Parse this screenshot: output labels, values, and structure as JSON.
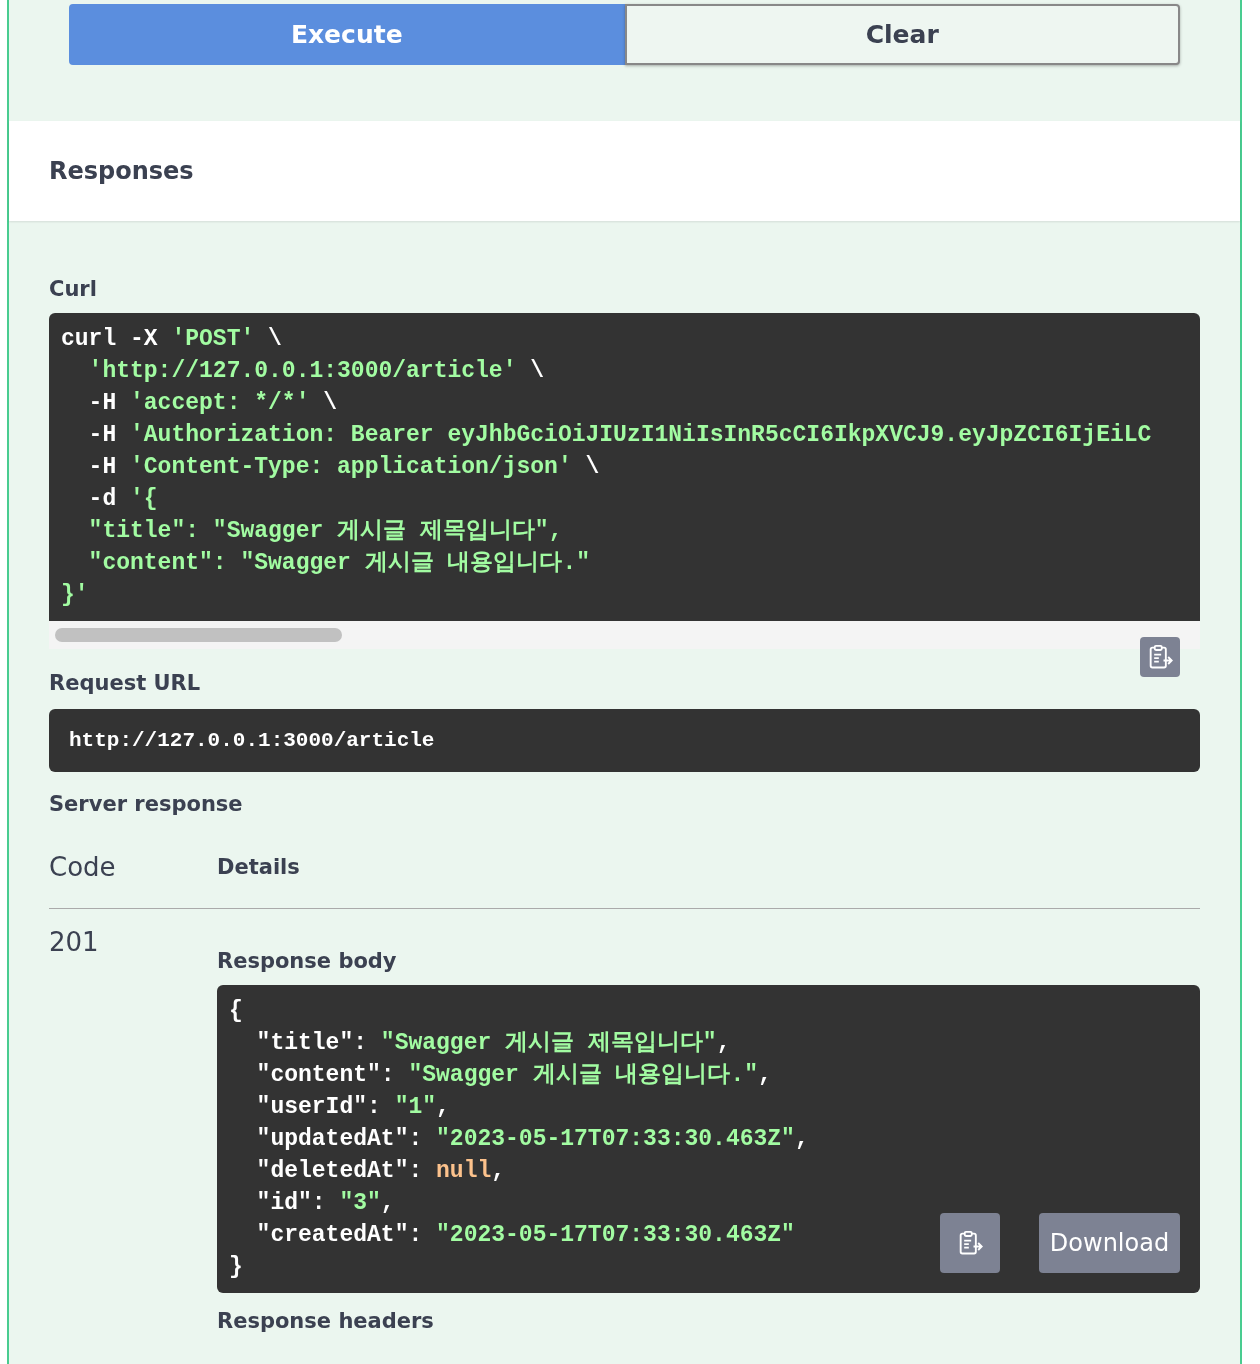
{
  "buttons": [
    {
      "label": "Execute",
      "kind": "primary"
    },
    {
      "label": "Clear",
      "kind": "secondary"
    }
  ],
  "responses_title": "Responses",
  "curl": {
    "label": "Curl",
    "lines": [
      [
        {
          "kind": "plain",
          "text": "curl -X "
        },
        {
          "kind": "string",
          "text": "'POST'"
        },
        {
          "kind": "plain",
          "text": " \\"
        }
      ],
      [
        {
          "kind": "string",
          "text": "  'http://127.0.0.1:3000/article'"
        },
        {
          "kind": "plain",
          "text": " \\"
        }
      ],
      [
        {
          "kind": "plain",
          "text": "  -H "
        },
        {
          "kind": "string",
          "text": "'accept: */*'"
        },
        {
          "kind": "plain",
          "text": " \\"
        }
      ],
      [
        {
          "kind": "plain",
          "text": "  -H "
        },
        {
          "kind": "string",
          "text": "'Authorization: Bearer eyJhbGciOiJIUzI1NiIsInR5cCI6IkpXVCJ9.eyJpZCI6IjEiLC"
        }
      ],
      [
        {
          "kind": "plain",
          "text": "  -H "
        },
        {
          "kind": "string",
          "text": "'Content-Type: application/json'"
        },
        {
          "kind": "plain",
          "text": " \\"
        }
      ],
      [
        {
          "kind": "plain",
          "text": "  -d "
        },
        {
          "kind": "string",
          "text": "'{"
        }
      ],
      [
        {
          "kind": "string",
          "text": "  \"title\": \"Swagger 게시글 제목입니다\","
        }
      ],
      [
        {
          "kind": "string",
          "text": "  \"content\": \"Swagger 게시글 내용입니다.\""
        }
      ],
      [
        {
          "kind": "string",
          "text": "}'"
        }
      ]
    ]
  },
  "request_url": {
    "label": "Request URL",
    "value": "http://127.0.0.1:3000/article"
  },
  "server_response": {
    "label": "Server response",
    "columns": [
      "Code",
      "Details"
    ],
    "code": "201",
    "body_label": "Response body",
    "body_lines": [
      [
        {
          "kind": "plain",
          "text": "{"
        }
      ],
      [
        {
          "kind": "plain",
          "text": "  \"title\": "
        },
        {
          "kind": "string",
          "text": "\"Swagger 게시글 제목입니다\""
        },
        {
          "kind": "plain",
          "text": ","
        }
      ],
      [
        {
          "kind": "plain",
          "text": "  \"content\": "
        },
        {
          "kind": "string",
          "text": "\"Swagger 게시글 내용입니다.\""
        },
        {
          "kind": "plain",
          "text": ","
        }
      ],
      [
        {
          "kind": "plain",
          "text": "  \"userId\": "
        },
        {
          "kind": "string",
          "text": "\"1\""
        },
        {
          "kind": "plain",
          "text": ","
        }
      ],
      [
        {
          "kind": "plain",
          "text": "  \"updatedAt\": "
        },
        {
          "kind": "string",
          "text": "\"2023-05-17T07:33:30.463Z\""
        },
        {
          "kind": "plain",
          "text": ","
        }
      ],
      [
        {
          "kind": "plain",
          "text": "  \"deletedAt\": "
        },
        {
          "kind": "null",
          "text": "null"
        },
        {
          "kind": "plain",
          "text": ","
        }
      ],
      [
        {
          "kind": "plain",
          "text": "  \"id\": "
        },
        {
          "kind": "string",
          "text": "\"3\""
        },
        {
          "kind": "plain",
          "text": ","
        }
      ],
      [
        {
          "kind": "plain",
          "text": "  \"createdAt\": "
        },
        {
          "kind": "string",
          "text": "\"2023-05-17T07:33:30.463Z\""
        }
      ],
      [
        {
          "kind": "plain",
          "text": "}"
        }
      ]
    ],
    "download_label": "Download",
    "headers_label": "Response headers"
  }
}
